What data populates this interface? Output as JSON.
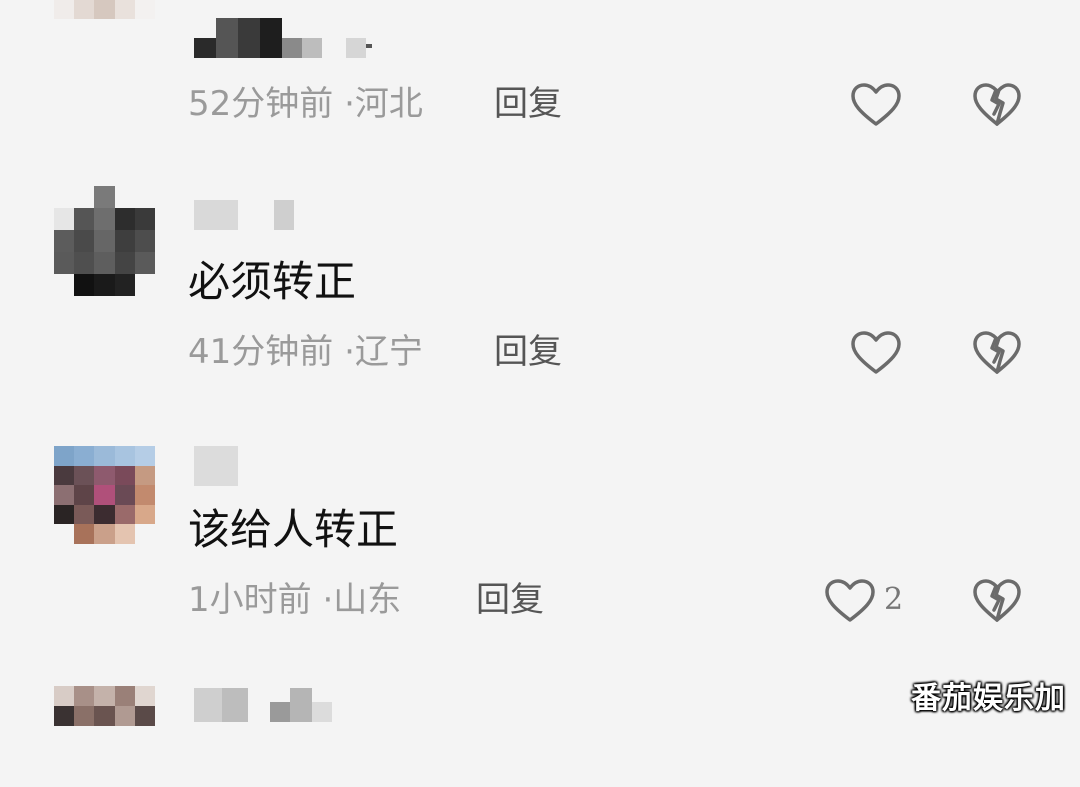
{
  "comments": [
    {
      "text": "",
      "time": "52分钟前",
      "location": "河北",
      "separator": "·",
      "reply_label": "回复",
      "like_count": ""
    },
    {
      "text": "必须转正",
      "time": "41分钟前",
      "location": "辽宁",
      "separator": "·",
      "reply_label": "回复",
      "like_count": ""
    },
    {
      "text": "该给人转正",
      "time": "1小时前",
      "location": "山东",
      "separator": "·",
      "reply_label": "回复",
      "like_count": "2"
    }
  ],
  "watermark": "番茄娱乐加",
  "icons": {
    "like": "heart-outline-icon",
    "dislike": "broken-heart-icon"
  },
  "colors": {
    "background": "#f4f4f4",
    "meta_text": "#9a9a9a",
    "icon_stroke": "#6b6b6b"
  }
}
